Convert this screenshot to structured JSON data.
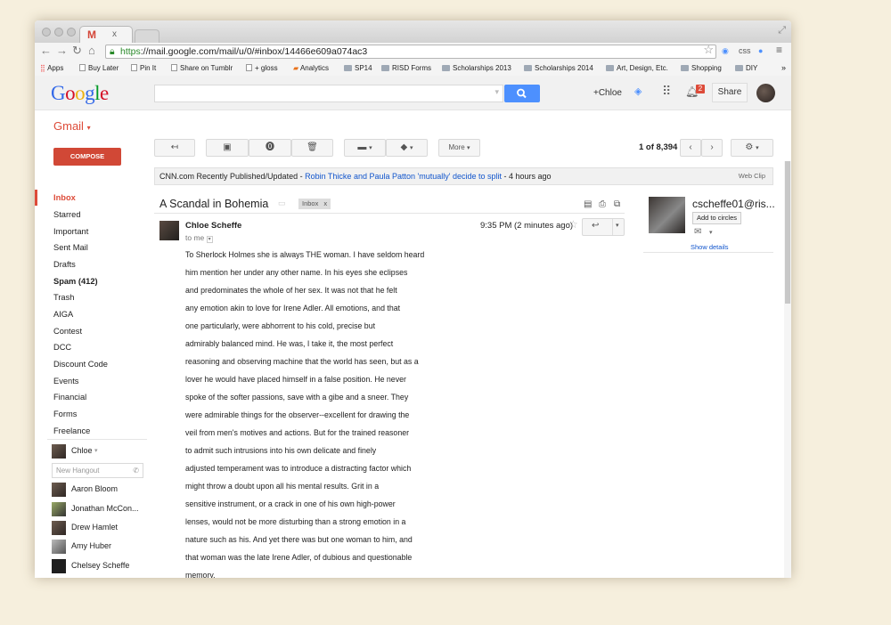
{
  "browser": {
    "tab_icon": "M",
    "tab_close": "x",
    "url_https": "https",
    "url_rest": "://mail.google.com/mail/u/0/#inbox/14466e609a074ac3",
    "ext_css": "css"
  },
  "bookmarks": [
    {
      "label": "Apps",
      "icon": "apps-icon"
    },
    {
      "label": "Buy Later",
      "icon": "page-icon"
    },
    {
      "label": "Pin It",
      "icon": "page-icon"
    },
    {
      "label": "Share on Tumblr",
      "icon": "page-icon"
    },
    {
      "label": "+ gloss",
      "icon": "page-icon"
    },
    {
      "label": "Analytics",
      "icon": "analytics-icon"
    },
    {
      "label": "SP14",
      "icon": "folder-icon"
    },
    {
      "label": "RISD Forms",
      "icon": "folder-icon"
    },
    {
      "label": "Scholarships 2013",
      "icon": "folder-icon"
    },
    {
      "label": "Scholarships 2014",
      "icon": "folder-icon"
    },
    {
      "label": "Art, Design, Etc.",
      "icon": "folder-icon"
    },
    {
      "label": "Shopping",
      "icon": "folder-icon"
    },
    {
      "label": "DIY",
      "icon": "folder-icon"
    },
    {
      "label": "»",
      "icon": "more-icon"
    }
  ],
  "header": {
    "logo": "Google",
    "plus_name": "+Chloe",
    "notifications": "2",
    "share": "Share"
  },
  "gmail": {
    "label": "Gmail",
    "compose": "COMPOSE"
  },
  "sidebar": [
    {
      "label": "Inbox",
      "active": true
    },
    {
      "label": "Starred"
    },
    {
      "label": "Important"
    },
    {
      "label": "Sent Mail"
    },
    {
      "label": "Drafts"
    },
    {
      "label": "Spam (412)",
      "bold": true
    },
    {
      "label": "Trash"
    },
    {
      "label": "AIGA"
    },
    {
      "label": "Contest"
    },
    {
      "label": "DCC"
    },
    {
      "label": "Discount Code"
    },
    {
      "label": "Events"
    },
    {
      "label": "Financial"
    },
    {
      "label": "Forms"
    },
    {
      "label": "Freelance"
    }
  ],
  "hangouts": {
    "me": "Chloe",
    "new_placeholder": "New Hangout",
    "contacts": [
      "Aaron Bloom",
      "Jonathan McCon...",
      "Drew Hamlet",
      "Amy Huber",
      "Chelsey Scheffe"
    ]
  },
  "toolbar": {
    "more": "More",
    "count": "1 of 8,394"
  },
  "webclip": {
    "source": "CNN.com Recently Published/Updated - ",
    "link": "Robin Thicke and Paula Patton 'mutually' decide to split",
    "age": " - 4 hours ago",
    "label": "Web Clip"
  },
  "message": {
    "subject": "A Scandal in Bohemia",
    "label": "Inbox",
    "label_x": "x",
    "sender": "Chloe Scheffe",
    "to": "to me",
    "time": "9:35 PM (2 minutes ago)",
    "body": [
      "To Sherlock Holmes she is always THE woman. I have seldom heard",
      "him mention her under any other name. In his eyes she eclipses",
      "and predominates the whole of her sex. It was not that he felt",
      "any emotion akin to love for Irene Adler. All emotions, and that",
      "one particularly, were abhorrent to his cold, precise but",
      "admirably balanced mind. He was, I take it, the most perfect",
      "reasoning and observing machine that the world has seen, but as a",
      "lover he would have placed himself in a false position. He never",
      "spoke of the softer passions, save with a gibe and a sneer. They",
      "were admirable things for the observer--excellent for drawing the",
      "veil from men's motives and actions. But for the trained reasoner",
      "to admit such intrusions into his own delicate and finely",
      "adjusted temperament was to introduce a distracting factor which",
      "might throw a doubt upon all his mental results. Grit in a",
      "sensitive instrument, or a crack in one of his own high-power",
      "lenses, would not be more disturbing than a strong emotion in a",
      "nature such as his. And yet there was but one woman to him, and",
      "that woman was the late Irene Adler, of dubious and questionable",
      "memory."
    ]
  },
  "contact_card": {
    "email": "cscheffe01@ris...",
    "add_circles": "Add to circles",
    "show_details": "Show details"
  },
  "colors": {
    "accent_red": "#dd4b39",
    "link_blue": "#1155cc",
    "search_blue": "#4d90fe"
  }
}
